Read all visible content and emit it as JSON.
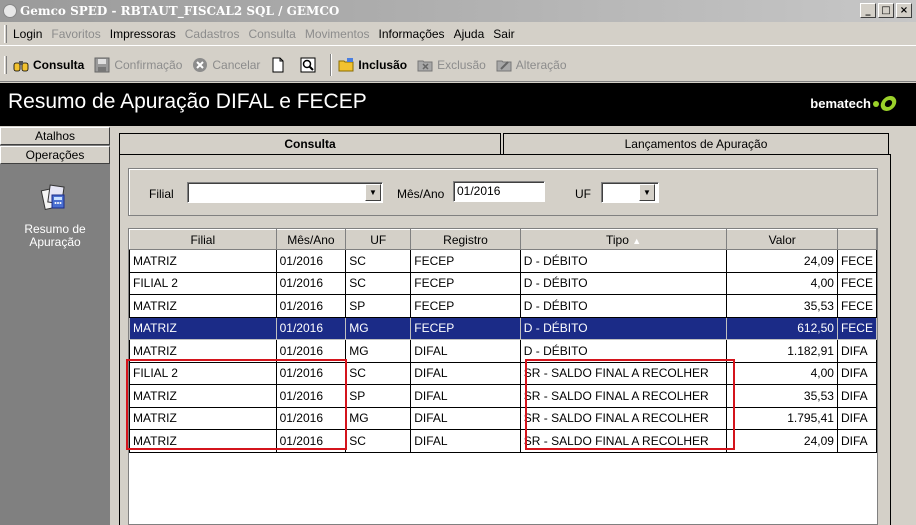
{
  "window": {
    "title": "Gemco SPED - RBTAUT_FISCAL2 SQL / GEMCO",
    "buttons": [
      "_",
      "□",
      "×"
    ]
  },
  "menu": [
    {
      "label": "Login",
      "enabled": true
    },
    {
      "label": "Favoritos",
      "enabled": false
    },
    {
      "label": "Impressoras",
      "enabled": true
    },
    {
      "label": "Cadastros",
      "enabled": false
    },
    {
      "label": "Consulta",
      "enabled": false
    },
    {
      "label": "Movimentos",
      "enabled": false
    },
    {
      "label": "Informações",
      "enabled": true
    },
    {
      "label": "Ajuda",
      "enabled": true
    },
    {
      "label": "Sair",
      "enabled": true
    }
  ],
  "toolbar": {
    "consulta": "Consulta",
    "confirmacao": "Confirmação",
    "cancelar": "Cancelar",
    "inclusao": "Inclusão",
    "exclusao": "Exclusão",
    "alteracao": "Alteração"
  },
  "header": {
    "title": "Resumo de Apuração DIFAL e FECEP",
    "brand": "bematech"
  },
  "sidebar": {
    "atalhos": "Atalhos",
    "operacoes": "Operações",
    "item_line1": "Resumo de",
    "item_line2": "Apuração"
  },
  "tabs": {
    "consulta": "Consulta",
    "lancamentos": "Lançamentos de Apuração"
  },
  "filters": {
    "filial_label": "Filial",
    "filial_value": "",
    "mes_ano_label": "Mês/Ano",
    "mes_ano_value": "01/2016",
    "uf_label": "UF",
    "uf_value": ""
  },
  "grid": {
    "columns": [
      "Filial",
      "Mês/Ano",
      "UF",
      "Registro",
      "Tipo",
      "Valor",
      ""
    ],
    "sort_indicator": "▲",
    "rows": [
      [
        "MATRIZ",
        "01/2016",
        "SC",
        "FECEP",
        "D - DÉBITO",
        "24,09",
        "FECE"
      ],
      [
        "FILIAL 2",
        "01/2016",
        "SC",
        "FECEP",
        "D - DÉBITO",
        "4,00",
        "FECE"
      ],
      [
        "MATRIZ",
        "01/2016",
        "SP",
        "FECEP",
        "D - DÉBITO",
        "35,53",
        "FECE"
      ],
      [
        "MATRIZ",
        "01/2016",
        "MG",
        "FECEP",
        "D - DÉBITO",
        "612,50",
        "FECE"
      ],
      [
        "MATRIZ",
        "01/2016",
        "MG",
        "DIFAL",
        "D - DÉBITO",
        "1.182,91",
        "DIFA"
      ],
      [
        "FILIAL 2",
        "01/2016",
        "SC",
        "DIFAL",
        "SR - SALDO FINAL A RECOLHER",
        "4,00",
        "DIFA"
      ],
      [
        "MATRIZ",
        "01/2016",
        "SP",
        "DIFAL",
        "SR - SALDO FINAL A RECOLHER",
        "35,53",
        "DIFA"
      ],
      [
        "MATRIZ",
        "01/2016",
        "MG",
        "DIFAL",
        "SR - SALDO FINAL A RECOLHER",
        "1.795,41",
        "DIFA"
      ],
      [
        "MATRIZ",
        "01/2016",
        "SC",
        "DIFAL",
        "SR - SALDO FINAL A RECOLHER",
        "24,09",
        "DIFA"
      ]
    ],
    "selected_row": 3
  },
  "colors": {
    "highlight_box": "#d4141c",
    "selection": "#1b2b87",
    "brand_accent": "#9bd12a"
  }
}
